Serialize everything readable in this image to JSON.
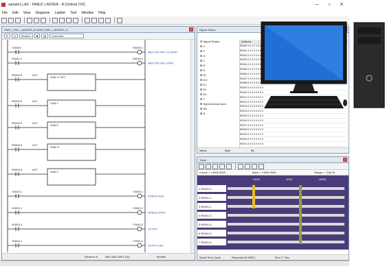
{
  "app": {
    "title": "sample1.LAD - FANUC LADDER - III   [Online] CNC",
    "menu": [
      "File",
      "Edit",
      "View",
      "Diagnose",
      "Ladder",
      "Tool",
      "Window",
      "Help"
    ]
  },
  "ladder": {
    "title": "PMC1_PMC_LADDER_B-MAIN_PMC_LADDER_L1",
    "toolbar": {
      "b1": "B",
      "b2": "Q",
      "restore": "Restore",
      "comment": "Comment"
    },
    "rows": [
      {
        "contact": "Y00000",
        "coil": "R0000.1",
        "note": "WAIT FOR PMC TO START"
      },
      {
        "contact": "F0001.0",
        "coil": "R0000.2",
        "note": "WAIT FOR PMC START"
      },
      {
        "contact": "R0000.5",
        "func": "ACT",
        "box": "SUB 3 / SFT",
        "note": ""
      },
      {
        "contact": "R0000.5",
        "func": "ACT",
        "box": "SUB 4",
        "note": ""
      },
      {
        "contact": "R0000.5",
        "func": "ACT",
        "box": "SUB 5",
        "note": ""
      },
      {
        "contact": "R0000.5",
        "func": "ACT",
        "box": "SUB 17",
        "note": ""
      },
      {
        "contact": "R0000.5",
        "func": "ACT",
        "box": "SUB 9",
        "note": ""
      },
      {
        "contact": "X0003.1",
        "coil": "Y0000.1",
        "note": "SPINDLE RUN"
      },
      {
        "contact": "X0003.2",
        "coil": "Y0000.2",
        "note": "SPINDLE STOP"
      },
      {
        "contact": "X0003.3",
        "coil": "Y0000.3",
        "note": "OUTPUT"
      },
      {
        "contact": "X0003.4",
        "coil": "Y0000.4",
        "note": "OUTPUT END"
      }
    ],
    "status": {
      "element": "Element: 8",
      "net": "Net: 0001-0001 (10)",
      "mode": "Monitor"
    }
  },
  "signal": {
    "title": "Signal Status",
    "tree": [
      "Signal Status",
      "X",
      "F",
      "G",
      "Y",
      "R",
      "D",
      "DI",
      "DO",
      "E1",
      "E2",
      "E3",
      "T",
      "Synchronous Input",
      "NS",
      "N"
    ],
    "headers": [
      "Address",
      "7",
      "6",
      "5",
      "4",
      "3",
      "2",
      "1",
      "0"
    ],
    "addresses": [
      "R0000",
      "R0001",
      "R0002",
      "R0003",
      "R0004",
      "R0005",
      "R0006",
      "R0007",
      "R0008",
      "R0009",
      "R0010",
      "R0011",
      "R0012",
      "R0013",
      "R0014",
      "R0015",
      "R0016",
      "R0017",
      "R0018",
      "R0019",
      "R0020",
      "R0021"
    ],
    "status": {
      "s1": "status",
      "s2": "Byte",
      "s3": "Bit"
    }
  },
  "trace": {
    "title": "Trace",
    "info": {
      "cursor": "Cursor = +0000 0000",
      "mark": "Mark = +0000 0000",
      "range": "Range = +184 M"
    },
    "axis": [
      "+0000",
      "-4000",
      "+8000"
    ],
    "signals": [
      "1 R0001.0",
      "2 R0001.1",
      "3 R0001.2",
      "4 R0001.3",
      "5 R0001.4",
      "6 R0001.5",
      "7 R0001.6"
    ],
    "status": {
      "mode": "Mode:Time Cycle",
      "res": "Resolution:8 MSEC",
      "time": "Time:?? Sec"
    }
  },
  "colors": {
    "yellow": "#e8c020",
    "olive": "#9a9a40",
    "trace_bg": "#4a3c78",
    "bar": "#d9d9d9"
  }
}
